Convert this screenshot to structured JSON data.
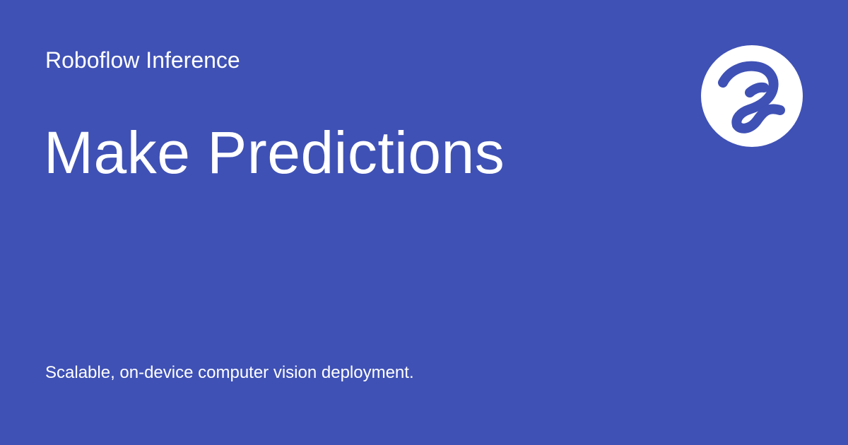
{
  "brand": {
    "product_name": "Roboflow Inference",
    "logo_icon": "roboflow-logo-icon"
  },
  "main": {
    "title": "Make Predictions",
    "tagline": "Scalable, on-device computer vision deployment."
  },
  "colors": {
    "background": "#3f51b5",
    "text": "#ffffff",
    "logo_circle": "#ffffff",
    "logo_mark": "#3f51b5"
  }
}
